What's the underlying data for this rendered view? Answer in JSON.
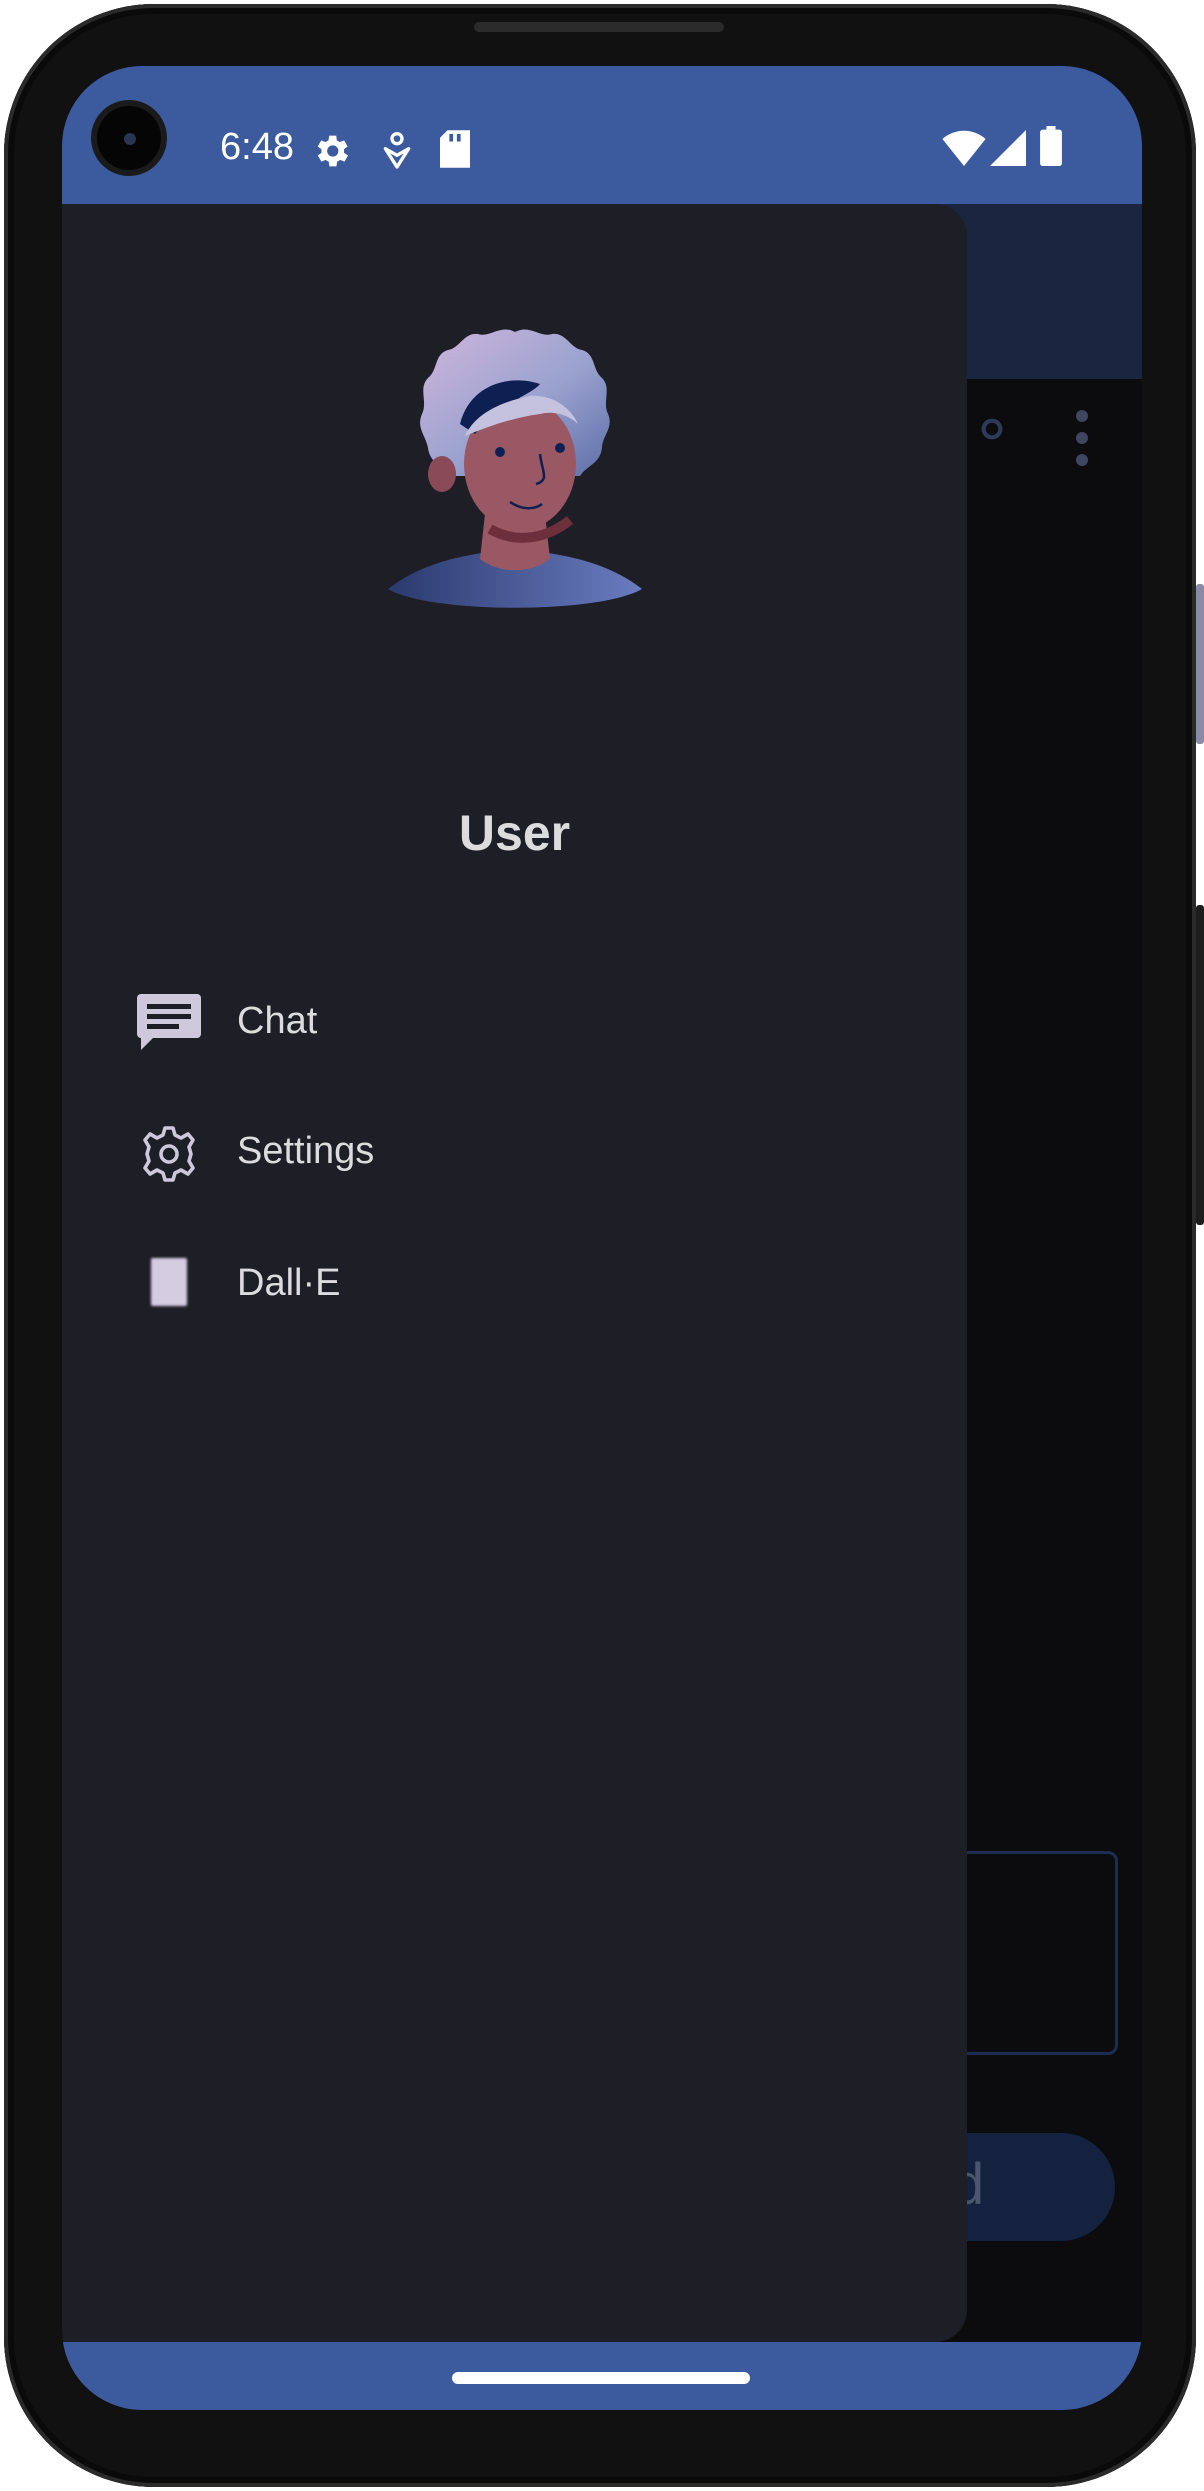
{
  "status_bar": {
    "time": "6:48"
  },
  "drawer": {
    "user_name": "User",
    "items": [
      {
        "label": "Chat",
        "icon": "chat-icon"
      },
      {
        "label": "Settings",
        "icon": "gear-icon"
      },
      {
        "label": "Dall·E",
        "icon": "image-icon"
      }
    ]
  },
  "background_app": {
    "button_label_fragment": "d"
  },
  "colors": {
    "status_bar": "#3c5b9e",
    "drawer_background": "#1e1e26",
    "text": "#dcdcdf"
  }
}
